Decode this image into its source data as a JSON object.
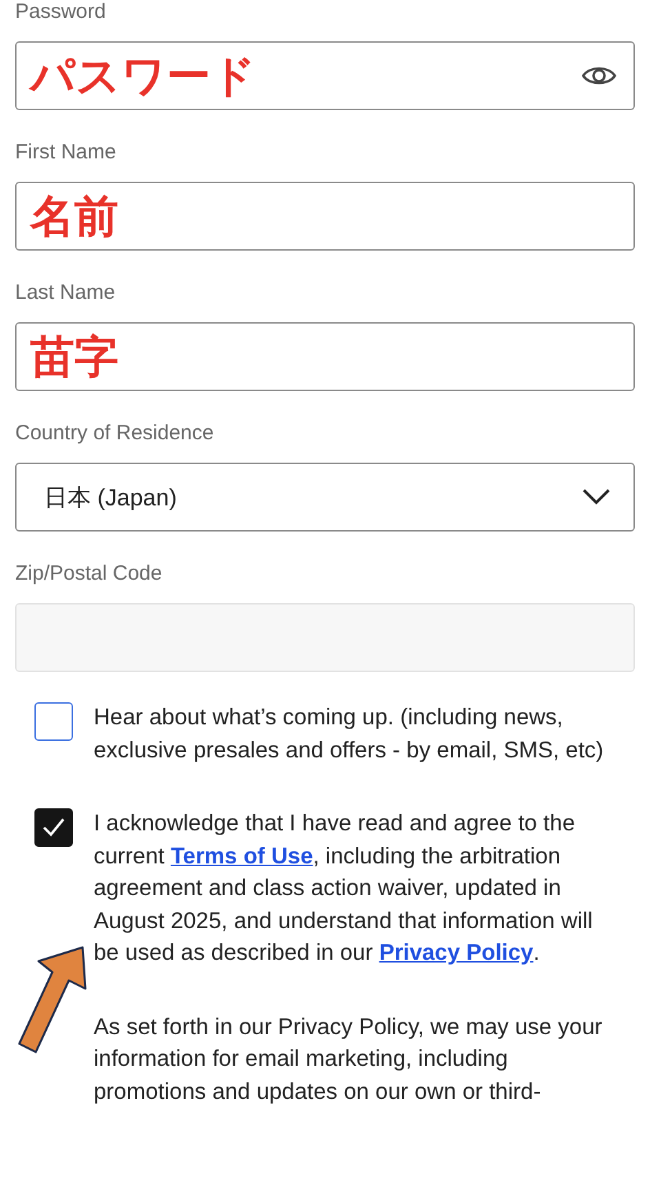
{
  "fields": [
    {
      "label": "Password",
      "kind": "password",
      "value": "パスワード",
      "disabled": false
    },
    {
      "label": "First Name",
      "kind": "text",
      "value": "名前",
      "disabled": false
    },
    {
      "label": "Last Name",
      "kind": "text",
      "value": "苗字",
      "disabled": false
    },
    {
      "label": "Country of Residence",
      "kind": "select",
      "value": "日本 (Japan)",
      "disabled": false
    },
    {
      "label": "Zip/Postal Code",
      "kind": "text",
      "disabled": true
    }
  ],
  "consents": [
    {
      "checked": false,
      "segments": [
        {
          "kind": "text",
          "text": "Hear about what’s coming up. (including news, exclusive presales and offers - by email, SMS, etc)"
        }
      ]
    },
    {
      "checked": true,
      "segments": [
        {
          "kind": "text",
          "text": "I acknowledge that I have read and agree to the current "
        },
        {
          "kind": "link",
          "text": "Terms of Use"
        },
        {
          "kind": "text",
          "text": ", including the arbitration agreement and class action waiver, updated in August 2025, and understand that information will be used as described in our "
        },
        {
          "kind": "link",
          "text": "Privacy Policy"
        },
        {
          "kind": "text",
          "text": "."
        }
      ]
    }
  ],
  "notice": "As set forth in our Privacy Policy, we may use your information for email marketing, including promotions and updates on our own or third-"
}
